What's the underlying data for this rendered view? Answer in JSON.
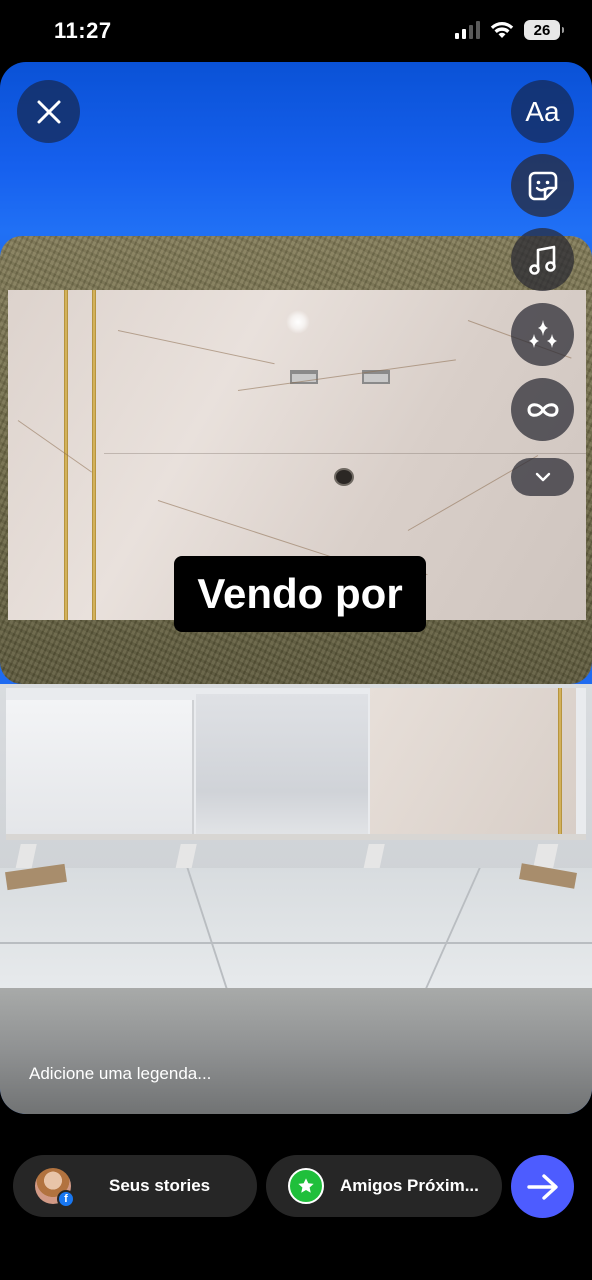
{
  "status_bar": {
    "time": "11:27",
    "battery": "26",
    "icons": [
      "cellular-signal-icon",
      "wifi-icon",
      "battery-icon"
    ]
  },
  "story": {
    "background_color": "#1660ee",
    "sticker_text": "Vendo por",
    "caption_placeholder": "Adicione uma legenda..."
  },
  "toolbar": {
    "close_icon": "close-icon",
    "text_label": "Aa",
    "tools": [
      "text-tool-icon",
      "sticker-icon",
      "music-icon",
      "effects-sparkle-icon",
      "boomerang-infinity-icon",
      "chevron-down-icon"
    ]
  },
  "share": {
    "your_stories_label": "Seus stories",
    "close_friends_label": "Amigos Próxim...",
    "send_icon": "arrow-right-icon",
    "accent_color": "#4d5cff",
    "close_friends_color": "#1fbf3b",
    "facebook_color": "#1877f2"
  }
}
